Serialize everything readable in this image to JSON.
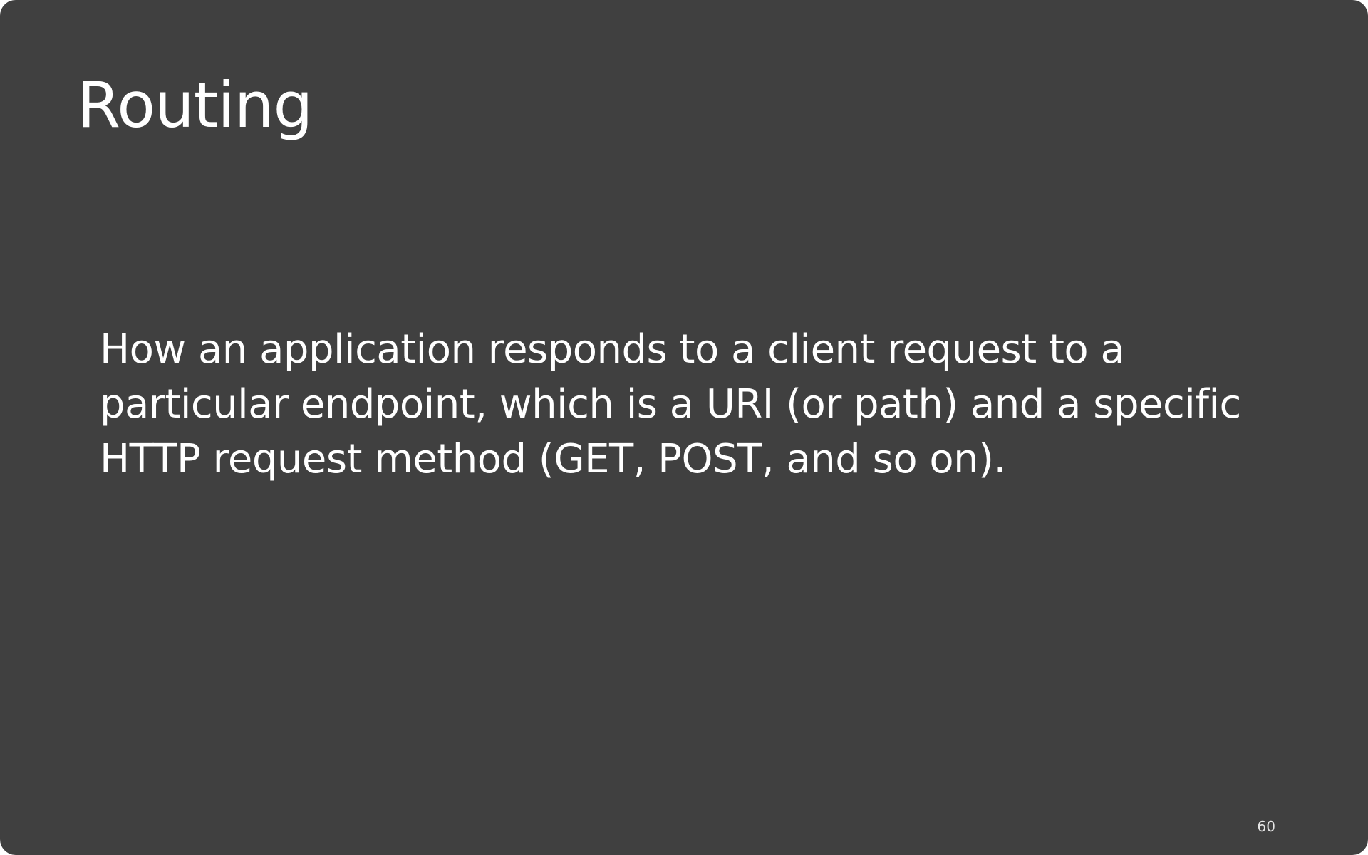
{
  "slide": {
    "title": "Routing",
    "body": "How an application responds to a client request to a particular endpoint, which is a URI (or path) and a specific HTTP request method (GET, POST, and so on).",
    "page_number": "60",
    "background_color": "#404040",
    "text_color": "#ffffff"
  }
}
